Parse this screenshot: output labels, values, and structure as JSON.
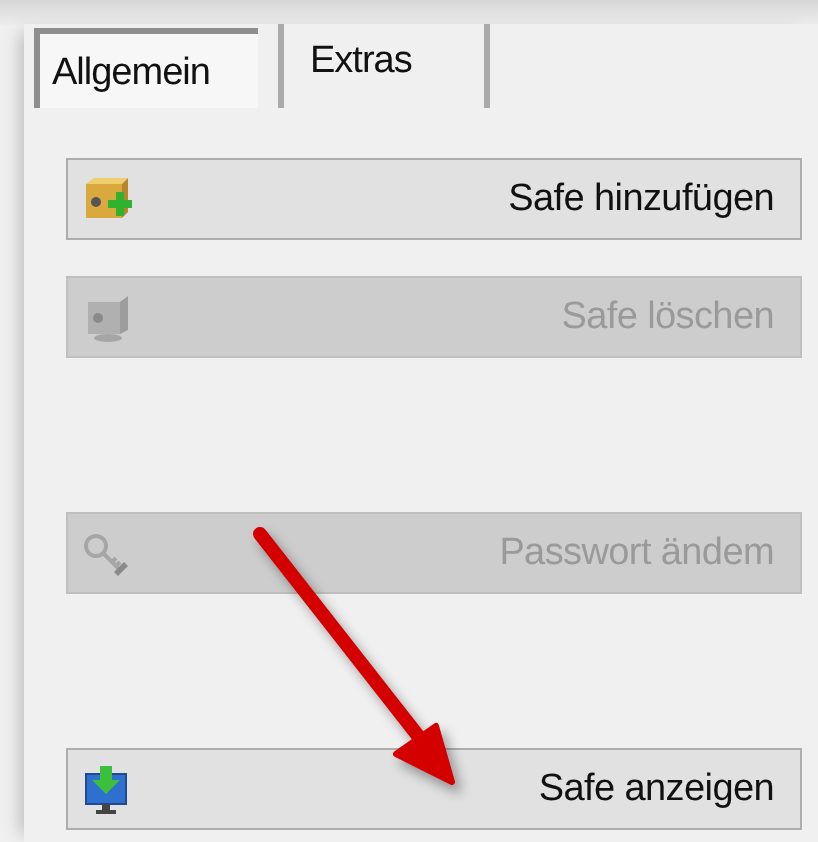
{
  "tabs": [
    {
      "label": "Allgemein",
      "selected": true
    },
    {
      "label": "Extras",
      "selected": false
    }
  ],
  "buttons": [
    {
      "kind": "add",
      "label": "Safe hinzufügen",
      "disabled": false
    },
    {
      "kind": "delete",
      "label": "Safe löschen",
      "disabled": true
    },
    {
      "kind": "password",
      "label": "Passwort ändem",
      "disabled": true
    },
    {
      "kind": "show",
      "label": "Safe anzeigen",
      "disabled": false
    }
  ]
}
